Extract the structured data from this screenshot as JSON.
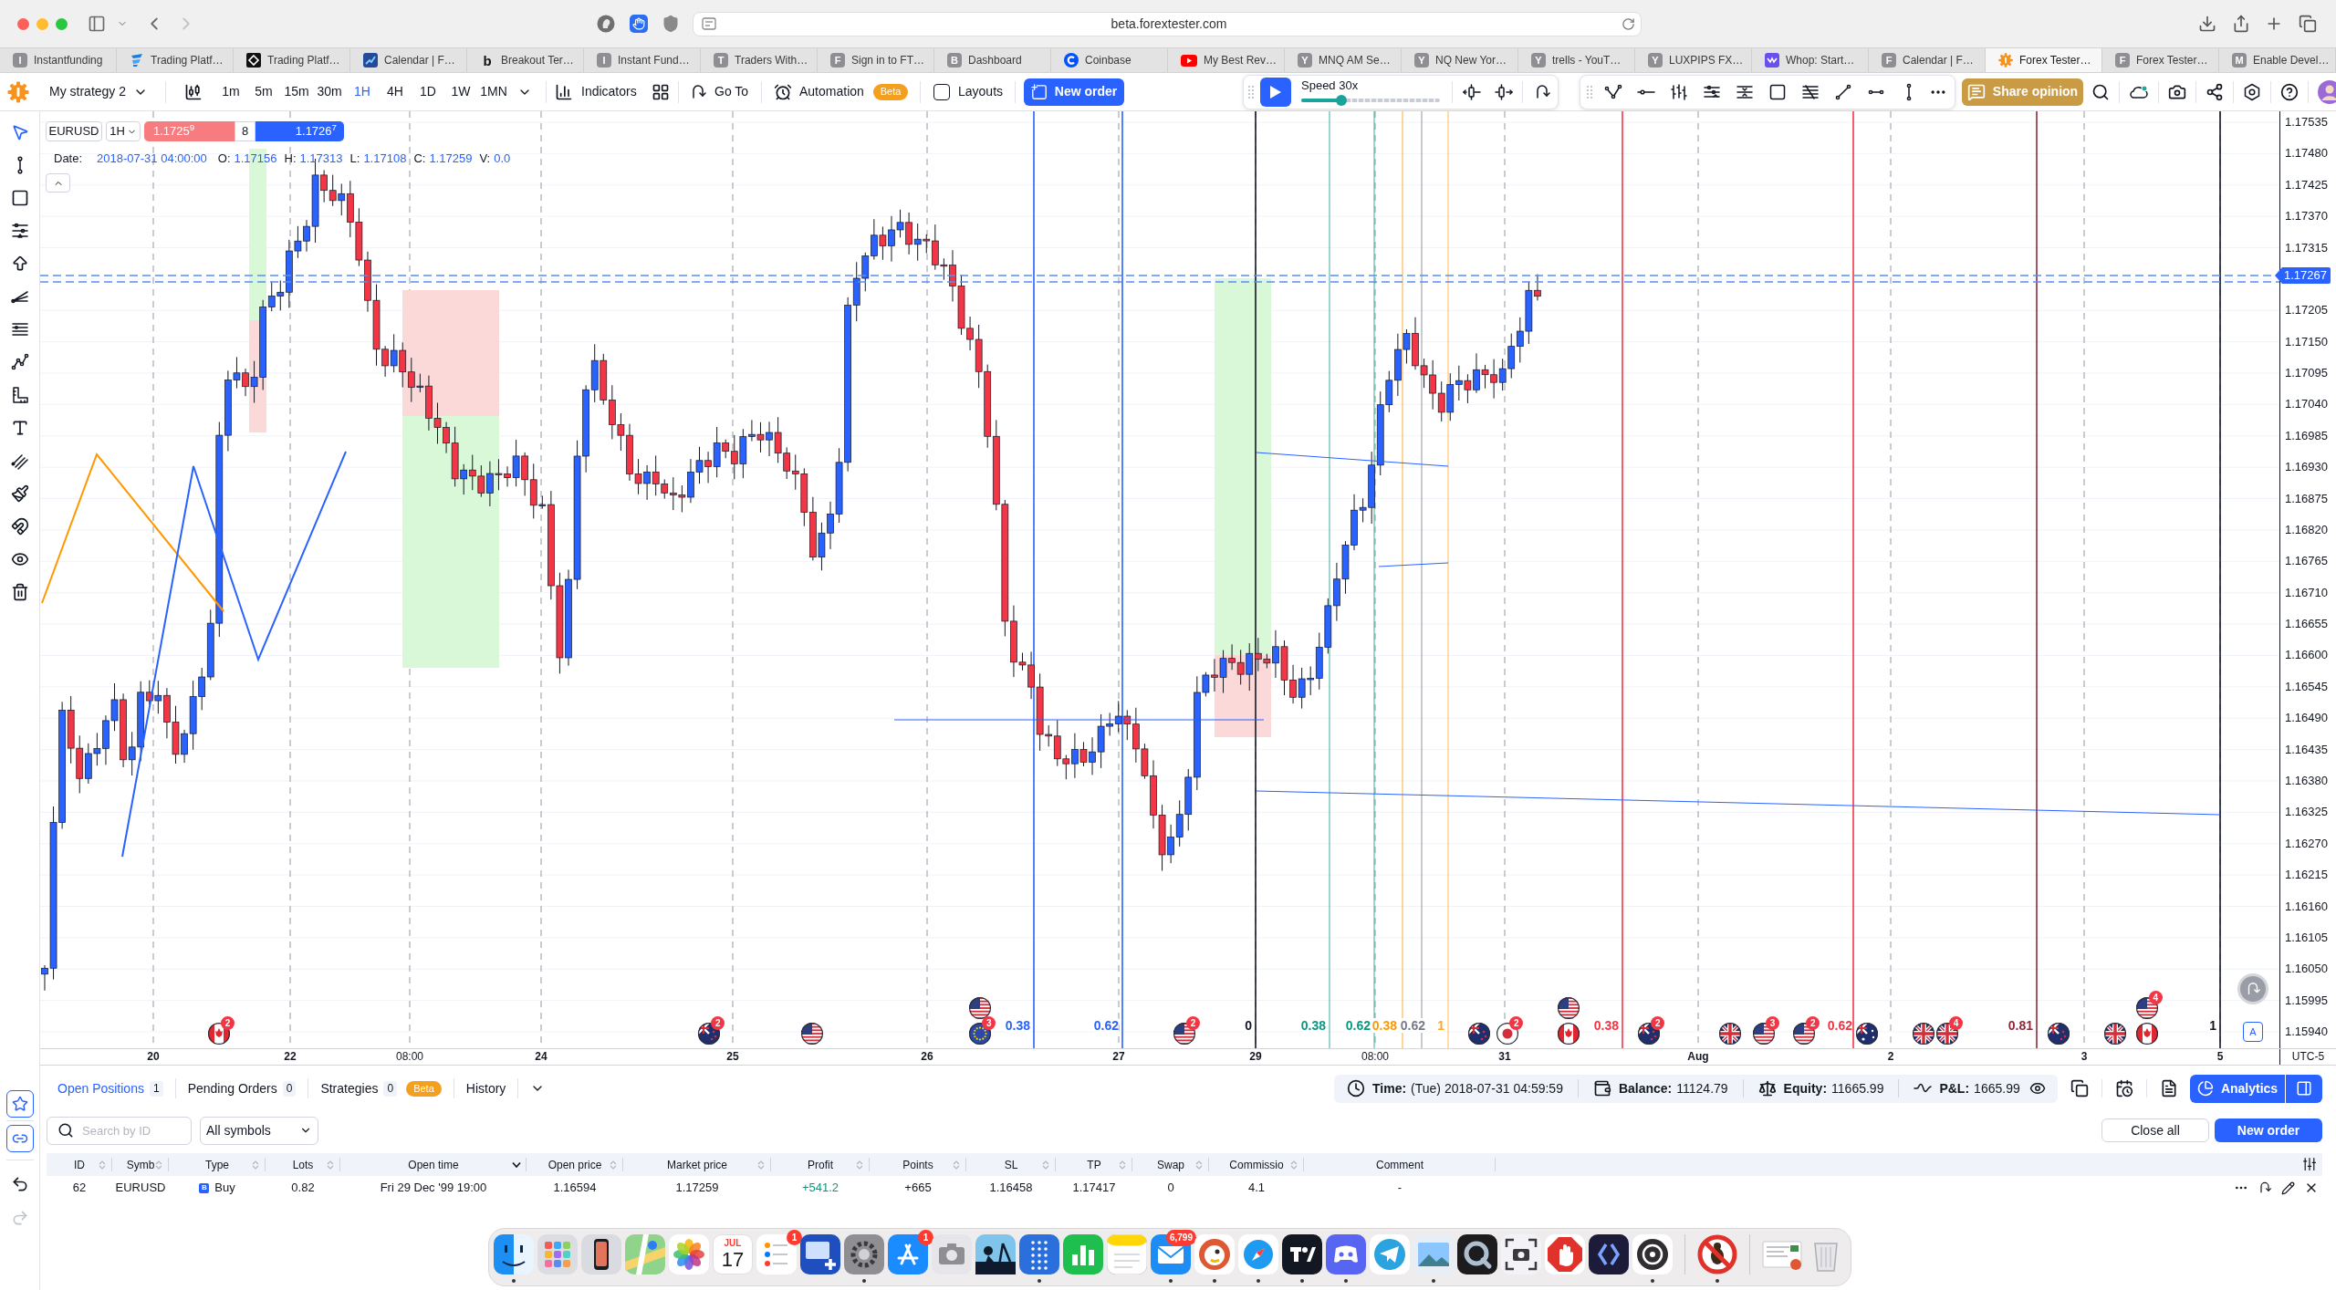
{
  "browser": {
    "address": "beta.forextester.com",
    "tabs": [
      {
        "title": "Instantfunding",
        "kind": "letter",
        "favicon": "I",
        "selected": false
      },
      {
        "title": "Trading Platf…",
        "kind": "logo",
        "selected": false
      },
      {
        "title": "Trading Platf…",
        "kind": "logo",
        "selected": false
      },
      {
        "title": "Calendar | F…",
        "kind": "logo",
        "selected": false
      },
      {
        "title": "Breakout Ter…",
        "kind": "glyph",
        "favicon": "b",
        "selected": false
      },
      {
        "title": "Instant Fund…",
        "kind": "letter",
        "favicon": "I",
        "selected": false
      },
      {
        "title": "Traders With…",
        "kind": "letter",
        "favicon": "T",
        "selected": false
      },
      {
        "title": "Sign in to FT…",
        "kind": "letter",
        "favicon": "F",
        "selected": false
      },
      {
        "title": "Dashboard",
        "kind": "letter",
        "favicon": "B",
        "selected": false
      },
      {
        "title": "Coinbase",
        "kind": "logo",
        "selected": false
      },
      {
        "title": "My Best Rev…",
        "kind": "logo",
        "selected": false
      },
      {
        "title": "MNQ AM Se…",
        "kind": "letter",
        "favicon": "Y",
        "selected": false
      },
      {
        "title": "NQ New Yor…",
        "kind": "letter",
        "favicon": "Y",
        "selected": false
      },
      {
        "title": "trells - YouT…",
        "kind": "letter",
        "favicon": "Y",
        "selected": false
      },
      {
        "title": "LUXPIPS FX…",
        "kind": "letter",
        "favicon": "Y",
        "selected": false
      },
      {
        "title": "Whop: Start…",
        "kind": "logo",
        "selected": false
      },
      {
        "title": "Calendar | F…",
        "kind": "letter",
        "favicon": "F",
        "selected": false
      },
      {
        "title": "Forex Tester…",
        "kind": "logo",
        "selected": true
      },
      {
        "title": "Forex Tester…",
        "kind": "letter",
        "favicon": "F",
        "selected": false
      },
      {
        "title": "Enable Devel…",
        "kind": "letter",
        "favicon": "M",
        "selected": false
      }
    ]
  },
  "toolbar": {
    "strategy": "My strategy 2",
    "timeframes": [
      {
        "label": "1m",
        "selected": false
      },
      {
        "label": "5m",
        "selected": false
      },
      {
        "label": "15m",
        "selected": false
      },
      {
        "label": "30m",
        "selected": false
      },
      {
        "label": "1H",
        "selected": true
      },
      {
        "label": "4H",
        "selected": false
      },
      {
        "label": "1D",
        "selected": false
      },
      {
        "label": "1W",
        "selected": false
      },
      {
        "label": "1MN",
        "selected": false
      }
    ],
    "indicators": "Indicators",
    "go_to": "Go To",
    "automation": "Automation",
    "automation_badge": "Beta",
    "layouts": {
      "label": "Layouts",
      "checked": false
    },
    "new_order": "New order",
    "playback": {
      "speed": "Speed 30x",
      "level": 0.29
    },
    "share_opinion": "Share opinion"
  },
  "chart": {
    "symbol": "EURUSD",
    "timeframe": "1H",
    "sell_price": "1.1725$^{9}$",
    "spread": "8",
    "buy_price": "1.1726$^{7}$",
    "ohlc": [
      {
        "label": "Date:",
        "value": "2018-07-31 04:00:00"
      },
      {
        "label": "O:",
        "value": "1.17156"
      },
      {
        "label": "H:",
        "value": "1.17313"
      },
      {
        "label": "L:",
        "value": "1.17108"
      },
      {
        "label": "C:",
        "value": "1.17259"
      },
      {
        "label": "V:",
        "value": "0.0"
      }
    ],
    "price_axis": {
      "labels": [
        "1.17535",
        "1.17480",
        "1.17425",
        "1.17370",
        "1.17315",
        "1.17205",
        "1.17150",
        "1.17095",
        "1.17040",
        "1.16985",
        "1.16930",
        "1.16875",
        "1.16820",
        "1.16765",
        "1.16710",
        "1.16655",
        "1.16600",
        "1.16545",
        "1.16490",
        "1.16435",
        "1.16380",
        "1.16325",
        "1.16270",
        "1.16215",
        "1.16160",
        "1.16105",
        "1.16050",
        "1.15995",
        "1.15940"
      ],
      "current": "1.17267"
    },
    "time_axis": {
      "labels": [
        {
          "label": "20",
          "kind": "day"
        },
        {
          "label": "22",
          "kind": "day"
        },
        {
          "label": "08:00",
          "kind": "time"
        },
        {
          "label": "24",
          "kind": "day"
        },
        {
          "label": "25",
          "kind": "day"
        },
        {
          "label": "26",
          "kind": "day"
        },
        {
          "label": "27",
          "kind": "day"
        },
        {
          "label": "29",
          "kind": "day"
        },
        {
          "label": "08:00",
          "kind": "time"
        },
        {
          "label": "31",
          "kind": "day"
        },
        {
          "label": "Aug",
          "kind": "day"
        },
        {
          "label": "2",
          "kind": "day"
        },
        {
          "label": "3",
          "kind": "day"
        },
        {
          "label": "5",
          "kind": "day"
        }
      ],
      "timezone": "UTC-5"
    },
    "level_labels": [
      {
        "text": "0.38",
        "color": "#2962ff"
      },
      {
        "text": "0.62",
        "color": "#2962ff"
      },
      {
        "text": "0",
        "color": "#131722"
      },
      {
        "text": "0.38",
        "color": "#089981"
      },
      {
        "text": "0.62",
        "color": "#089981"
      },
      {
        "text": "0.38",
        "color": "#ff9800"
      },
      {
        "text": "0.62",
        "color": "#787b86"
      },
      {
        "text": "1",
        "color": "#ffa726"
      },
      {
        "text": "0.38",
        "color": "#f23645"
      },
      {
        "text": "0.62",
        "color": "#f23645"
      },
      {
        "text": "0.81",
        "color": "#8e2a3a"
      },
      {
        "text": "1",
        "color": "#131722"
      }
    ],
    "events": [
      {
        "kind": "ca",
        "badge": "2"
      },
      {
        "kind": "nz",
        "badge": "2"
      },
      {
        "kind": "us"
      },
      {
        "kind": "us"
      },
      {
        "kind": "eu",
        "badge": "3"
      },
      {
        "kind": "us",
        "badge": "2"
      },
      {
        "kind": "nz"
      },
      {
        "kind": "jp",
        "badge": "2"
      },
      {
        "kind": "us"
      },
      {
        "kind": "ca"
      },
      {
        "kind": "nz",
        "badge": "2"
      },
      {
        "kind": "uk"
      },
      {
        "kind": "us",
        "badge": "3"
      },
      {
        "kind": "us",
        "badge": "2"
      },
      {
        "kind": "au"
      },
      {
        "kind": "uk"
      },
      {
        "kind": "uk",
        "badge": "4"
      },
      {
        "kind": "nz"
      },
      {
        "kind": "uk"
      },
      {
        "kind": "us",
        "badge": "4"
      },
      {
        "kind": "ca"
      }
    ],
    "auto_scale": "A"
  },
  "positions": {
    "tabs": [
      {
        "label": "Open Positions",
        "count": "1",
        "selected": true
      },
      {
        "label": "Pending Orders",
        "count": "0",
        "selected": false
      },
      {
        "label": "Strategies",
        "count": "0",
        "badge": "Beta",
        "selected": false
      },
      {
        "label": "History",
        "selected": false
      }
    ],
    "search": {
      "placeholder": "Search by ID"
    },
    "symbol_filter": "All symbols",
    "status": [
      {
        "label": "Time:",
        "value": "(Tue) 2018-07-31 04:59:59"
      },
      {
        "label": "Balance:",
        "value": "11124.79"
      },
      {
        "label": "Equity:",
        "value": "11665.99"
      },
      {
        "label": "P&L:",
        "value": "1665.99"
      }
    ],
    "analytics": "Analytics",
    "close_all": "Close all",
    "new_order": "New order",
    "columns": [
      {
        "label": "ID",
        "sortable": true,
        "sorted": false
      },
      {
        "label": "Symb",
        "sortable": true,
        "sorted": false
      },
      {
        "label": "Type",
        "sortable": true,
        "sorted": false
      },
      {
        "label": "Lots",
        "sortable": true,
        "sorted": false
      },
      {
        "label": "Open time",
        "sortable": true,
        "sorted": true
      },
      {
        "label": "Open price",
        "sortable": true,
        "sorted": false
      },
      {
        "label": "Market price",
        "sortable": true,
        "sorted": false
      },
      {
        "label": "Profit",
        "sortable": true,
        "sorted": false
      },
      {
        "label": "Points",
        "sortable": true,
        "sorted": false
      },
      {
        "label": "SL",
        "sortable": true,
        "sorted": false
      },
      {
        "label": "TP",
        "sortable": true,
        "sorted": false
      },
      {
        "label": "Swap",
        "sortable": true,
        "sorted": false
      },
      {
        "label": "Commissio",
        "sortable": true,
        "sorted": false
      },
      {
        "label": "Comment",
        "sortable": false
      }
    ],
    "rows": [
      {
        "id": "62",
        "symbol": "EURUSD",
        "type_badge": "B",
        "type": "Buy",
        "lots": "0.82",
        "open_time": "Fri 29 Dec '99 19:00",
        "open_price": "1.16594",
        "market_price": "1.17259",
        "profit": "+541.2",
        "points": "+665",
        "sl": "1.16458",
        "tp": "1.17417",
        "swap": "0",
        "commission": "4.1",
        "comment": "-"
      }
    ]
  },
  "dock": {
    "apps": [
      {
        "kind": "face",
        "running": true
      },
      {
        "kind": "grid",
        "running": false
      },
      {
        "kind": "phone",
        "running": false
      },
      {
        "kind": "map",
        "running": false
      },
      {
        "kind": "flower",
        "running": false
      },
      {
        "kind": "calendar",
        "month": "JUL",
        "day": "17",
        "running": false
      },
      {
        "kind": "checklist",
        "badge": "1",
        "running": false
      },
      {
        "kind": "screenplus",
        "running": false
      },
      {
        "kind": "gear",
        "running": true
      },
      {
        "kind": "store",
        "badge": "1",
        "running": false
      },
      {
        "kind": "camera",
        "running": false
      },
      {
        "kind": "reader",
        "running": false
      },
      {
        "kind": "dots",
        "running": true
      },
      {
        "kind": "chart",
        "running": false
      },
      {
        "kind": "notepad",
        "running": false
      },
      {
        "kind": "envelope",
        "badge": "6,799",
        "running": true
      },
      {
        "kind": "duck",
        "running": true
      },
      {
        "kind": "compass",
        "running": true
      },
      {
        "kind": "tile",
        "running": true
      },
      {
        "kind": "controller",
        "running": true
      },
      {
        "kind": "plane",
        "running": false
      },
      {
        "kind": "photo",
        "running": true
      },
      {
        "kind": "lens",
        "running": false
      },
      {
        "kind": "screenshot",
        "running": false
      },
      {
        "kind": "hand",
        "running": false
      },
      {
        "kind": "brackets",
        "running": false
      },
      {
        "kind": "record",
        "running": true
      },
      {
        "kind": "blocked",
        "running": true
      },
      {
        "kind": "window",
        "running": false
      },
      {
        "kind": "trash",
        "running": false
      }
    ]
  }
}
